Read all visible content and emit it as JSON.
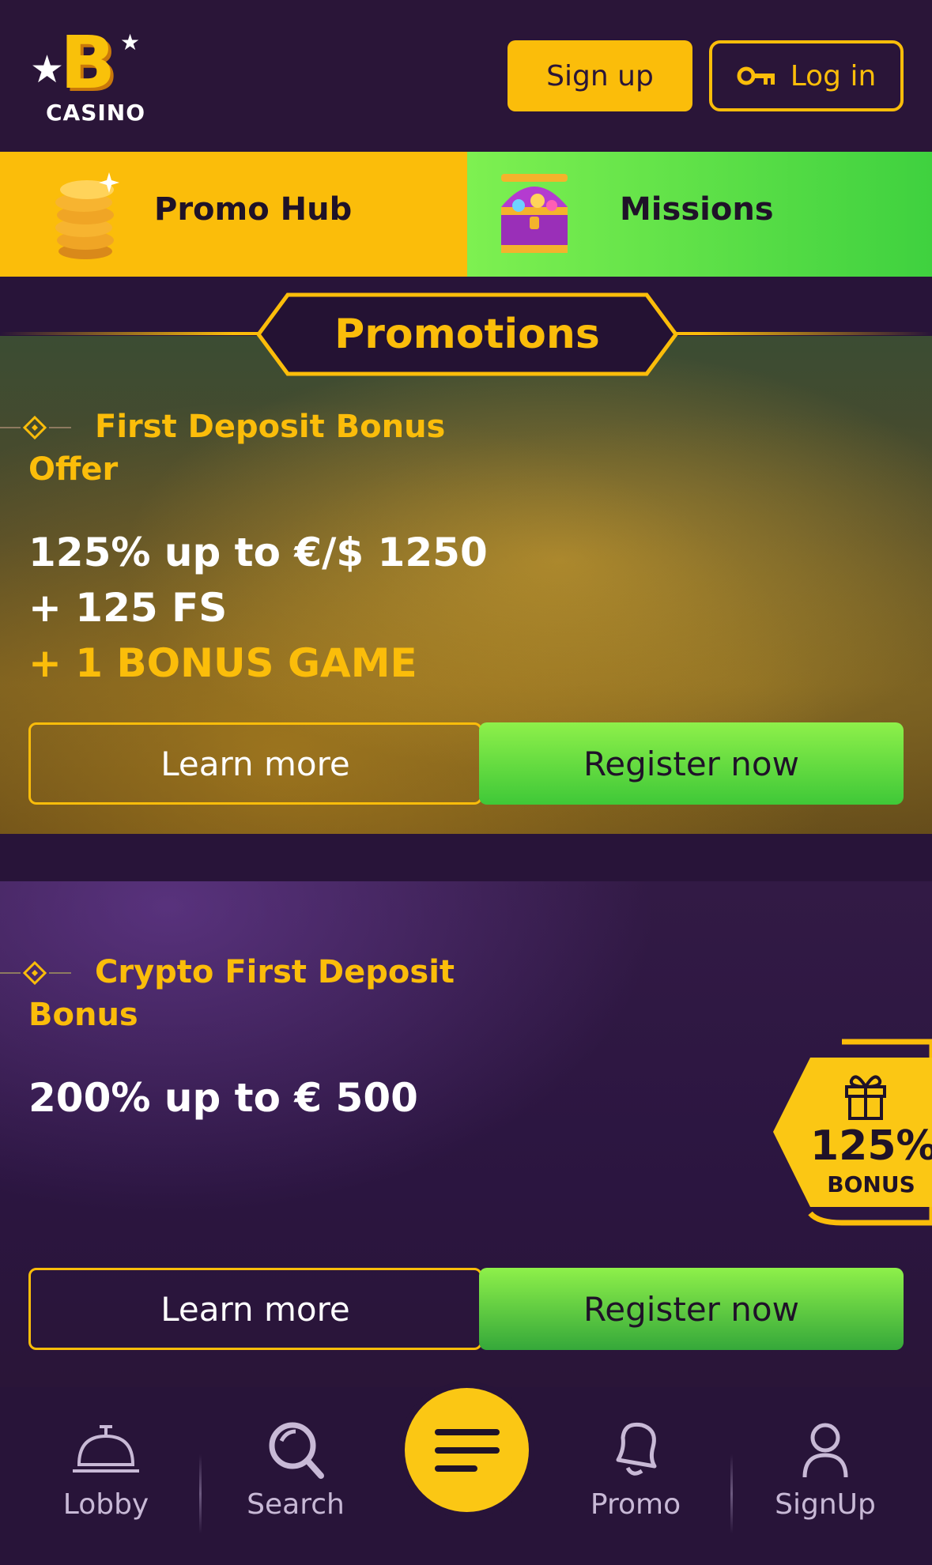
{
  "header": {
    "logo_text": "CASINO",
    "logo_letter": "B",
    "signup_label": "Sign up",
    "login_label": "Log in"
  },
  "tiles": {
    "promo_hub_label": "Promo Hub",
    "missions_label": "Missions"
  },
  "section_title": "Promotions",
  "offers": [
    {
      "label": "First Deposit Bonus Offer",
      "line1": "125% up to €/$ 1250",
      "line2": "+ 125 FS",
      "line3": "+ 1 BONUS GAME",
      "learn_label": "Learn more",
      "register_label": "Register now"
    },
    {
      "label": "Crypto First Deposit Bonus",
      "line1": "200% up to € 500",
      "learn_label": "Learn more",
      "register_label": "Register now",
      "badge_percent": "125%",
      "badge_word": "BONUS"
    }
  ],
  "bottom_nav": {
    "items": [
      {
        "label": "Lobby",
        "icon": "bell-service-icon"
      },
      {
        "label": "Search",
        "icon": "search-icon"
      },
      {
        "label": "Promo",
        "icon": "notification-bell-icon"
      },
      {
        "label": "SignUp",
        "icon": "user-icon"
      }
    ],
    "menu_icon": "menu-icon"
  },
  "colors": {
    "background": "#281439",
    "accent_yellow": "#fbbd0a",
    "accent_green": "#3fd13f"
  }
}
